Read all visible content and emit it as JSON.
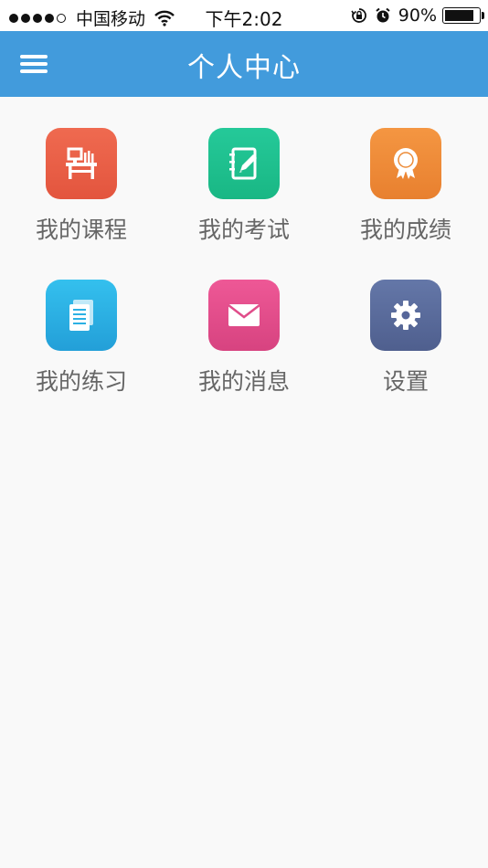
{
  "status_bar": {
    "carrier": "中国移动",
    "time": "下午2:02",
    "battery_percent": "90%",
    "battery_level": 0.9
  },
  "navbar": {
    "title": "个人中心",
    "menu_icon": "hamburger-menu-icon"
  },
  "tiles": [
    {
      "label": "我的课程",
      "icon": "desk-icon",
      "color": "#ec6148"
    },
    {
      "label": "我的考试",
      "icon": "notebook-pencil-icon",
      "color": "#1fc18f"
    },
    {
      "label": "我的成绩",
      "icon": "award-badge-icon",
      "color": "#f08c3a"
    },
    {
      "label": "我的练习",
      "icon": "document-stack-icon",
      "color": "#2eb6e4"
    },
    {
      "label": "我的消息",
      "icon": "envelope-icon",
      "color": "#e84c8c"
    },
    {
      "label": "设置",
      "icon": "gear-icon",
      "color": "#5b6c9c"
    }
  ]
}
